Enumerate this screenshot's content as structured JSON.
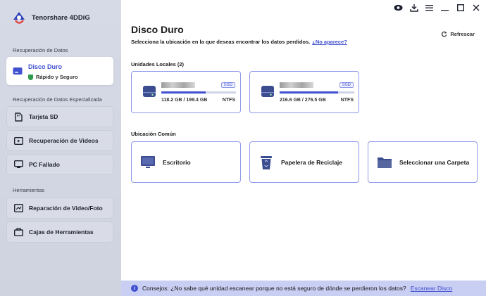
{
  "app": {
    "name": "Tenorshare 4DDiG"
  },
  "sidebar": {
    "section_recovery": "Recuperación de Datos",
    "active_item": {
      "label": "Disco Duro",
      "sub": "Rápido y Seguro"
    },
    "section_special": "Recuperación de Datos Especializada",
    "special_items": [
      {
        "label": "Tarjeta SD",
        "icon": "sd-card-icon"
      },
      {
        "label": "Recuperación de Videos",
        "icon": "video-icon"
      },
      {
        "label": "PC Fallado",
        "icon": "pc-icon"
      }
    ],
    "section_tools": "Herramientas",
    "tool_items": [
      {
        "label": "Reparación de Video/Foto",
        "icon": "repair-icon"
      },
      {
        "label": "Cajas de Herramientas",
        "icon": "toolbox-icon"
      }
    ]
  },
  "main": {
    "title": "Disco Duro",
    "subtitle": "Selecciona la ubicación en la que deseas encontrar los datos perdidos.",
    "subtitle_link": "¿No aparece?",
    "refresh": "Refrescar",
    "local_label": "Unidades Locales (2)",
    "drives": [
      {
        "type": "SSD",
        "size": "118.2 GB / 199.4 GB",
        "fs": "NTFS",
        "used_fraction": 0.59
      },
      {
        "type": "SSD",
        "size": "216.6 GB / 276.5 GB",
        "fs": "NTFS",
        "used_fraction": 0.78
      }
    ],
    "common_label": "Ubicación Común",
    "locations": [
      {
        "label": "Escritorio",
        "icon": "desktop-icon"
      },
      {
        "label": "Papelera de Reciclaje",
        "icon": "recycle-bin-icon"
      },
      {
        "label": "Seleccionar una Carpeta",
        "icon": "folder-icon"
      }
    ]
  },
  "tip": {
    "text": "Consejos: ¿No sabe qué unidad escanear porque no está seguro de dónde se perdieron los datos?",
    "link": "Escanear Disco"
  },
  "colors": {
    "accent": "#3f4fd0",
    "sidebar": "#d6dae6",
    "tipbar": "#c9cef3"
  }
}
